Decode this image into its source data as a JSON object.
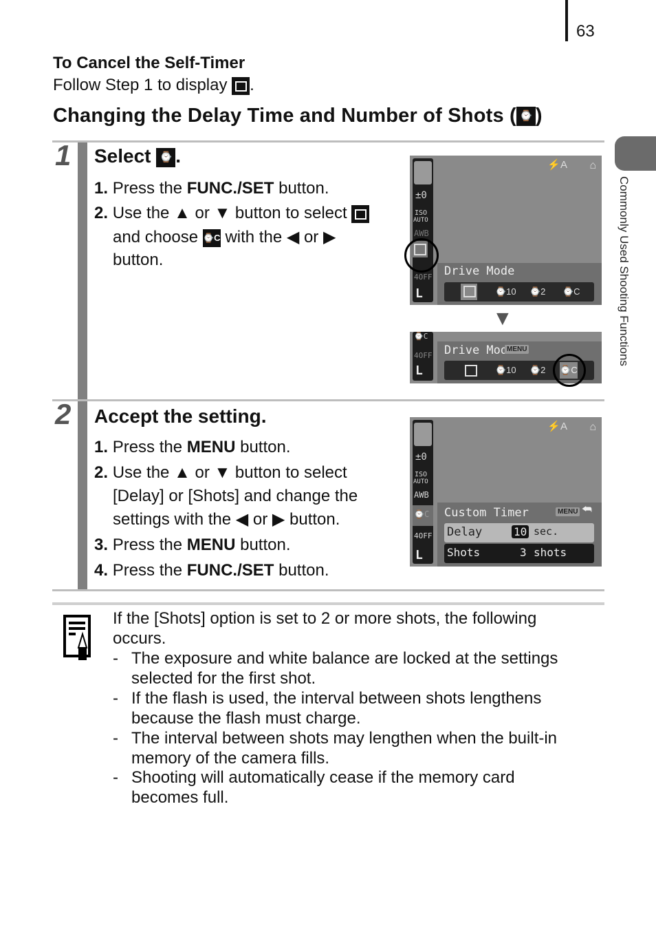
{
  "page": {
    "number": "63",
    "side_tab": "Commonly Used Shooting Functions"
  },
  "cancel": {
    "title": "To Cancel the Self-Timer",
    "body": "Follow Step 1 to display",
    "period": "."
  },
  "section_title": "Changing the Delay Time and Number of Shots (",
  "section_title_end": ")",
  "step1": {
    "num": "1",
    "title": "Select",
    "title_end": ".",
    "l1a": "1.",
    "l1b": "Press the",
    "l1c": "FUNC./SET",
    "l1d": "button.",
    "l2a": "2.",
    "l2b": "Use the ▲ or ▼ button to select",
    "l3a": "and choose",
    "l3b": "with the ◀ or ▶",
    "l4": "button."
  },
  "step2": {
    "num": "2",
    "title": "Accept the setting.",
    "items": [
      {
        "n": "1.",
        "pre": "Press the",
        "b": "MENU",
        "post": "button."
      },
      {
        "n": "2.",
        "text": "Use the ▲ or ▼ button to select"
      },
      {
        "text": "[Delay] or [Shots] and change the"
      },
      {
        "text": "settings with the ◀ or ▶ button."
      },
      {
        "n": "3.",
        "pre": "Press the",
        "b": "MENU",
        "post": "button."
      },
      {
        "n": "4.",
        "pre": "Press the",
        "b": "FUNC./SET",
        "post": "button."
      }
    ]
  },
  "screen1": {
    "left": [
      "±0",
      "ISO",
      "AUTO",
      "AWB",
      "4OFF",
      "L"
    ],
    "flash": "⚡A",
    "menu_label": "Drive Mode",
    "options": [
      "□",
      "⌚10",
      "⌚2",
      "⌚C"
    ]
  },
  "screen2": {
    "menu_label": "Drive Mode",
    "menu_badge": "MENU",
    "options": [
      "□",
      "⌚10",
      "⌚2",
      "⌚C"
    ]
  },
  "screen3": {
    "title": "Custom Timer",
    "menu_badge": "MENU",
    "back": "⮪",
    "delay_label": "Delay",
    "delay_value": "10",
    "delay_unit": "sec.",
    "shots_label": "Shots",
    "shots_value": "3",
    "shots_unit": "shots"
  },
  "arrow_down": "▼",
  "note": {
    "intro1": "If the [Shots] option is set to 2 or more shots, the following",
    "intro2": "occurs.",
    "bullets": [
      [
        "The exposure and white balance are locked at the settings",
        "selected for the first shot."
      ],
      [
        "If the flash is used, the interval between shots lengthens",
        "because the flash must charge."
      ],
      [
        "The interval between shots may lengthen when the built-in",
        "memory of the camera fills."
      ],
      [
        "Shooting will automatically cease if the memory card",
        "becomes full."
      ]
    ]
  },
  "icons": {
    "timer_c": "⌚C"
  }
}
